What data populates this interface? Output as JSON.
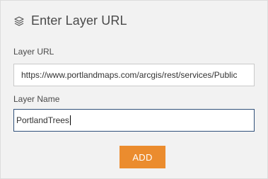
{
  "header": {
    "icon": "layers-icon",
    "title": "Enter Layer URL"
  },
  "form": {
    "url_label": "Layer URL",
    "url_value": "https://www.portlandmaps.com/arcgis/rest/services/Public",
    "name_label": "Layer Name",
    "name_value": "PortlandTrees"
  },
  "actions": {
    "add_label": "ADD"
  },
  "colors": {
    "accent": "#eb8c2e",
    "focus_border": "#30507a",
    "panel_bg": "#f2f2f2"
  }
}
